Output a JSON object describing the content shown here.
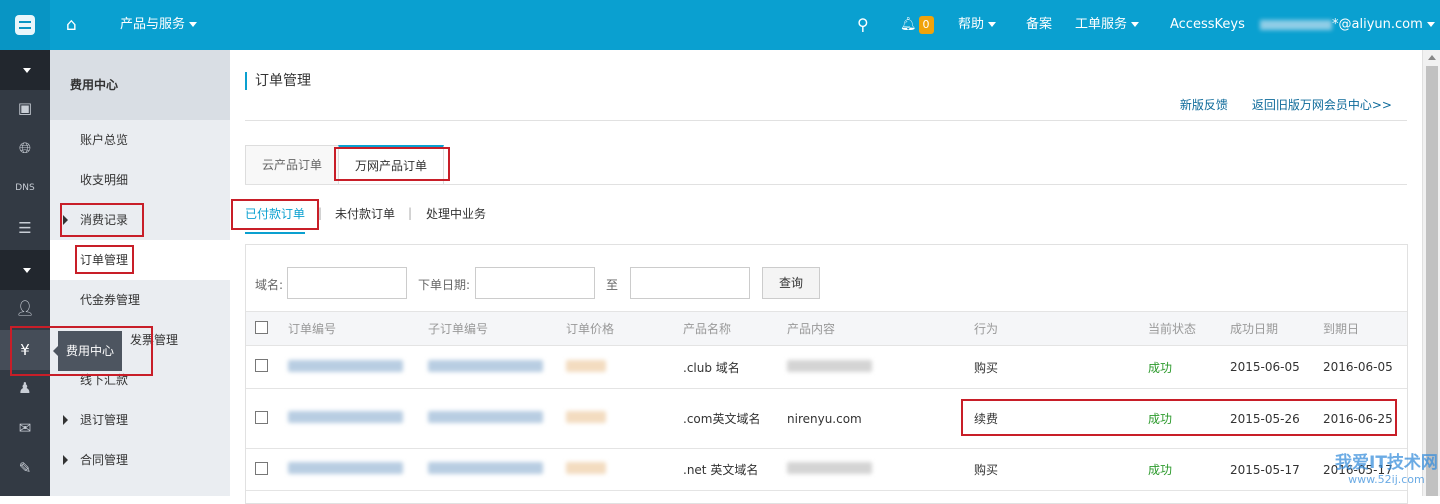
{
  "topbar": {
    "products": "产品与服务",
    "notifications": "0",
    "help": "帮助",
    "beian": "备案",
    "tickets": "工单服务",
    "accesskeys": "AccessKeys",
    "account": "*@aliyun.com"
  },
  "sidebar": {
    "header": "费用中心",
    "items": [
      "账户总览",
      "收支明细",
      "消费记录",
      "订单管理",
      "代金券管理",
      "发票管理",
      "线下汇款",
      "退订管理",
      "合同管理"
    ],
    "tooltip": "费用中心"
  },
  "main": {
    "title": "订单管理",
    "links": [
      "新版反馈",
      "返回旧版万网会员中心>>"
    ],
    "tabs": [
      "云产品订单",
      "万网产品订单"
    ],
    "subtabs": [
      "已付款订单",
      "未付款订单",
      "处理中业务"
    ],
    "filter": {
      "domain_label": "域名:",
      "date_label": "下单日期:",
      "to_label": "至",
      "query": "查询"
    },
    "columns": [
      "订单编号",
      "子订单编号",
      "订单价格",
      "产品名称",
      "产品内容",
      "行为",
      "当前状态",
      "成功日期",
      "到期日"
    ],
    "rows": [
      {
        "product": ".club 域名",
        "content": "",
        "action": "购买",
        "status": "成功",
        "success": "2015-06-05",
        "expire": "2016-06-05"
      },
      {
        "product": ".com英文域名",
        "content": "nirenyu.com",
        "action": "续费",
        "status": "成功",
        "success": "2015-05-26",
        "expire": "2016-06-25"
      },
      {
        "product": ".net 英文域名",
        "content": "",
        "action": "购买",
        "status": "成功",
        "success": "2015-05-17",
        "expire": "2016-05-17"
      }
    ]
  },
  "watermark": {
    "text": "我爱IT技术网",
    "url": "www.52ij.com"
  }
}
